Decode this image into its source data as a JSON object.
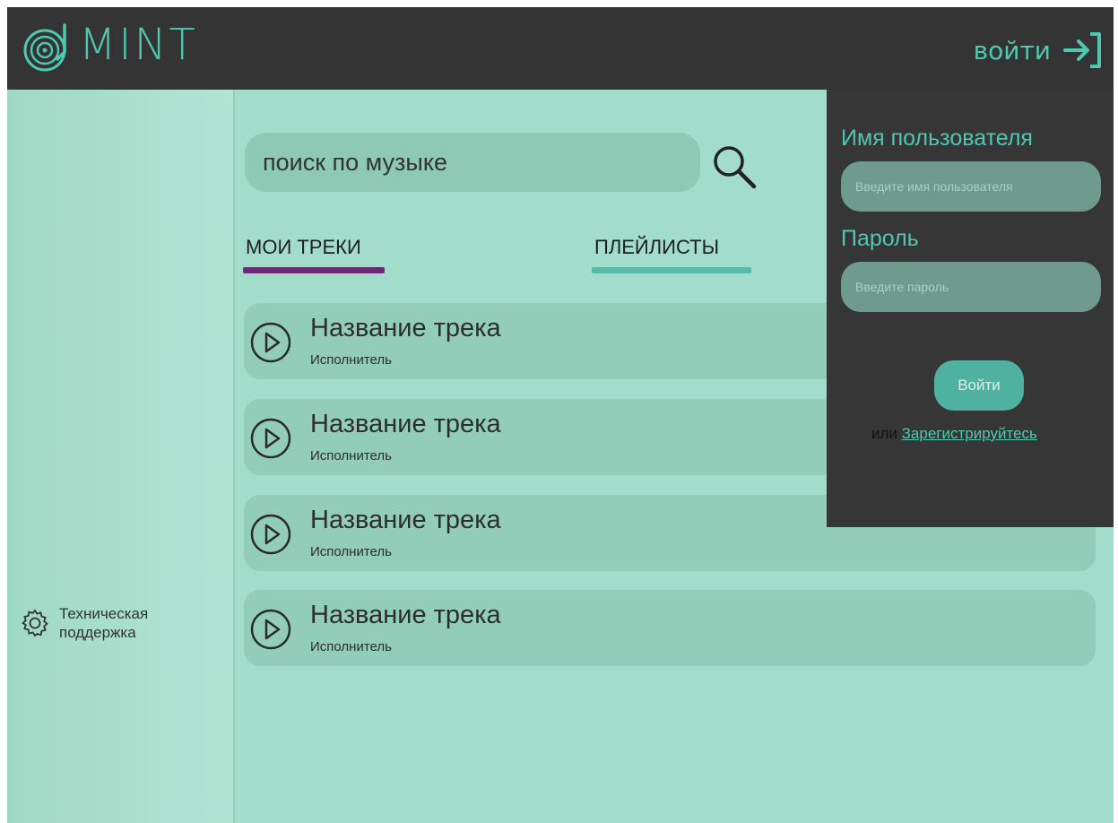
{
  "app": {
    "logo_text": "MINT",
    "login_link_label": "войти"
  },
  "search": {
    "placeholder": "поиск по музыке"
  },
  "tabs": [
    {
      "label": "МОИ ТРЕКИ",
      "active": true,
      "underline_color": "#6a2a74"
    },
    {
      "label": "ПЛЕЙЛИСТЫ",
      "active": false,
      "underline_color": "#5ab8a6"
    }
  ],
  "tracks": [
    {
      "title": "Название трека",
      "artist": "Исполнитель"
    },
    {
      "title": "Название трека",
      "artist": "Исполнитель"
    },
    {
      "title": "Название трека",
      "artist": "Исполнитель"
    },
    {
      "title": "Название трека",
      "artist": "Исполнитель"
    }
  ],
  "sidebar": {
    "support_label": "Техническая поддержка",
    "support_icon": "gear-icon"
  },
  "login_panel": {
    "username_label": "Имя пользователя",
    "username_placeholder": "Введите имя пользователя",
    "password_label": "Пароль",
    "password_placeholder": "Введите пароль",
    "submit_label": "Войти",
    "or_text": "или",
    "register_label": "Зарегистрируйтесь"
  },
  "colors": {
    "accent": "#4ec9b0",
    "topbar": "#343434",
    "background": "#a2dcca",
    "panel": "#363636"
  }
}
